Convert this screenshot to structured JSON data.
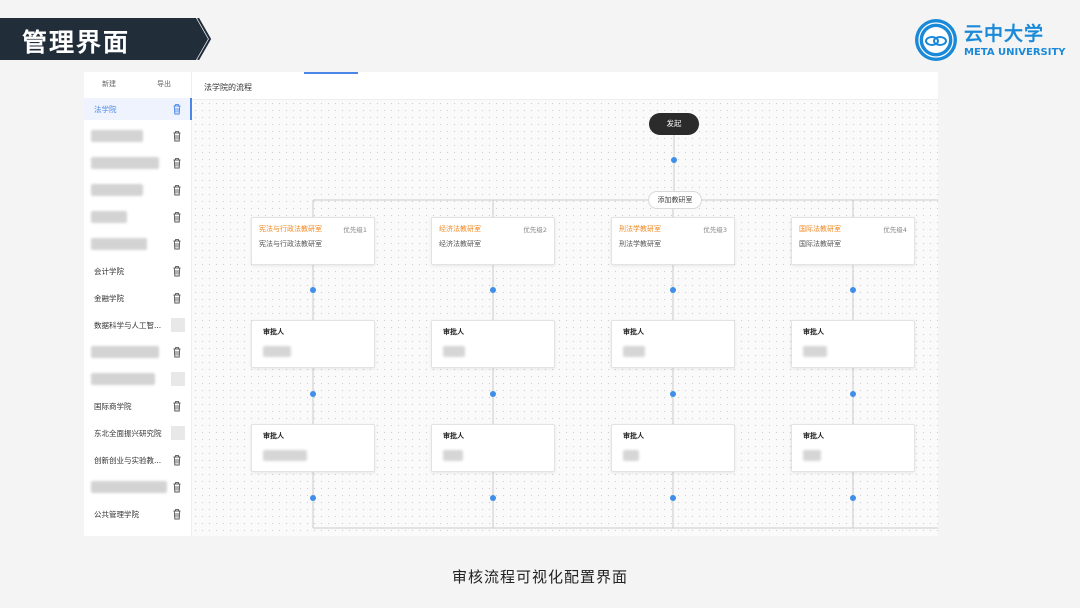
{
  "slide": {
    "title": "管理界面",
    "caption": "审核流程可视化配置界面",
    "banner_color": "#222d3a"
  },
  "logo": {
    "name_cn": "云中大学",
    "name_en": "META UNIVERSITY",
    "color": "#1a8ad8"
  },
  "sidebar": {
    "new_label": "新建",
    "export_label": "导出",
    "items": [
      {
        "label": "法学院",
        "active": true,
        "redacted": false,
        "action": "trash"
      },
      {
        "label": "",
        "active": false,
        "redacted": true,
        "action": "trash"
      },
      {
        "label": "",
        "active": false,
        "redacted": true,
        "action": "trash"
      },
      {
        "label": "",
        "active": false,
        "redacted": true,
        "action": "trash"
      },
      {
        "label": "",
        "active": false,
        "redacted": true,
        "action": "trash"
      },
      {
        "label": "",
        "active": false,
        "redacted": true,
        "action": "trash"
      },
      {
        "label": "会计学院",
        "active": false,
        "redacted": false,
        "action": "trash"
      },
      {
        "label": "金融学院",
        "active": false,
        "redacted": false,
        "action": "trash"
      },
      {
        "label": "数据科学与人工智...",
        "active": false,
        "redacted": false,
        "action": "blank"
      },
      {
        "label": "",
        "active": false,
        "redacted": true,
        "action": "trash"
      },
      {
        "label": "",
        "active": false,
        "redacted": true,
        "action": "blank"
      },
      {
        "label": "国际商学院",
        "active": false,
        "redacted": false,
        "action": "trash"
      },
      {
        "label": "东北全面振兴研究院",
        "active": false,
        "redacted": false,
        "action": "blank"
      },
      {
        "label": "创新创业与实验教...",
        "active": false,
        "redacted": false,
        "action": "trash"
      },
      {
        "label": "",
        "active": false,
        "redacted": true,
        "action": "trash"
      },
      {
        "label": "公共管理学院",
        "active": false,
        "redacted": false,
        "action": "trash"
      }
    ]
  },
  "flow": {
    "title": "法学院的流程",
    "start_label": "发起",
    "add_dept_label": "添加教研室",
    "departments": [
      {
        "name": "宪法与行政法教研室",
        "priority": "优先级1",
        "subtitle": "宪法与行政法教研室"
      },
      {
        "name": "经济法教研室",
        "priority": "优先级2",
        "subtitle": "经济法教研室"
      },
      {
        "name": "刑法学教研室",
        "priority": "优先级3",
        "subtitle": "刑法学教研室"
      },
      {
        "name": "国际法教研室",
        "priority": "优先级4",
        "subtitle": "国际法教研室"
      }
    ],
    "approver_label": "审批人",
    "accent_color": "#f08a24",
    "dot_color": "#3f8ee8"
  }
}
